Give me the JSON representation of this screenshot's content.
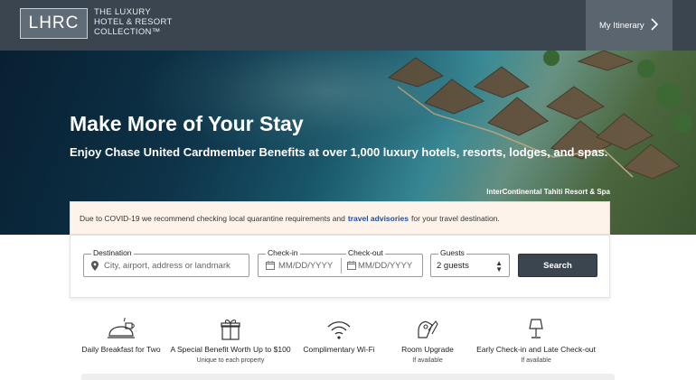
{
  "header": {
    "logo_abbr": "LHRC",
    "logo_line1": "THE LUXURY",
    "logo_line2": "HOTEL & RESORT",
    "logo_line3": "COLLECTION™",
    "itinerary_label": "My Itinerary"
  },
  "hero": {
    "title": "Make More of Your Stay",
    "subtitle": "Enjoy Chase United Cardmember Benefits at over 1,000 luxury hotels, resorts, lodges, and spas.",
    "photo_credit": "InterContinental Tahiti Resort & Spa"
  },
  "notice": {
    "text_before": "Due to COVID-19 we recommend checking local quarantine requirements and",
    "link": "travel advisories",
    "text_after": "for your travel destination."
  },
  "search": {
    "destination_label": "Destination",
    "destination_placeholder": "City, airport, address or landmark",
    "checkin_label": "Check-in",
    "checkin_placeholder": "MM/DD/YYYY",
    "checkout_label": "Check-out",
    "checkout_placeholder": "MM/DD/YYYY",
    "guests_label": "Guests",
    "guests_value": "2 guests",
    "search_label": "Search"
  },
  "benefits": [
    {
      "icon": "breakfast-icon",
      "title": "Daily Breakfast for Two",
      "sub": ""
    },
    {
      "icon": "gift-icon",
      "title": "A Special Benefit Worth Up to $100",
      "sub": "Unique to each property"
    },
    {
      "icon": "wifi-icon",
      "title": "Complimentary Wi-Fi",
      "sub": ""
    },
    {
      "icon": "key-icon",
      "title": "Room Upgrade",
      "sub": "If available"
    },
    {
      "icon": "lamp-icon",
      "title": "Early Check-in and Late Check-out",
      "sub": "If available"
    }
  ],
  "colors": {
    "header_bg": "#3a4550",
    "accent_link": "#1f4fa0",
    "notice_bg": "#fdf3ea",
    "button_bg": "#3a4550"
  }
}
